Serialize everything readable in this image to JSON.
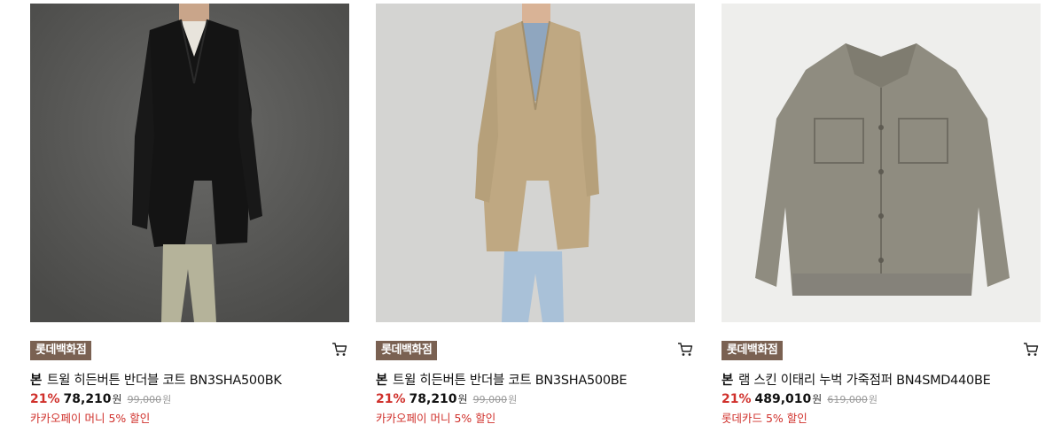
{
  "products": [
    {
      "store": "롯데백화점",
      "brand": "본",
      "name": "트윌 히든버튼 반더블 코트 BN3SHA500BK",
      "discount": "21%",
      "price": "78,210",
      "currency": "원",
      "original_price": "99,000",
      "original_currency": "원",
      "promo": "카카오페이 머니 5% 할인",
      "image_subject": "black coat on model",
      "cart_icon": "cart-icon"
    },
    {
      "store": "롯데백화점",
      "brand": "본",
      "name": "트윌 히든버튼 반더블 코트 BN3SHA500BE",
      "discount": "21%",
      "price": "78,210",
      "currency": "원",
      "original_price": "99,000",
      "original_currency": "원",
      "promo": "카카오페이 머니 5% 할인",
      "image_subject": "beige coat on model",
      "cart_icon": "cart-icon"
    },
    {
      "store": "롯데백화점",
      "brand": "본",
      "name": "램 스킨 이태리 누벅 가죽점퍼 BN4SMD440BE",
      "discount": "21%",
      "price": "489,010",
      "currency": "원",
      "original_price": "619,000",
      "original_currency": "원",
      "promo": "롯데카드 5% 할인",
      "image_subject": "nubuck leather jacket",
      "cart_icon": "cart-icon"
    }
  ],
  "colors": {
    "badge_bg": "#7a6152",
    "discount": "#d0302b",
    "promo": "#d0302b"
  }
}
